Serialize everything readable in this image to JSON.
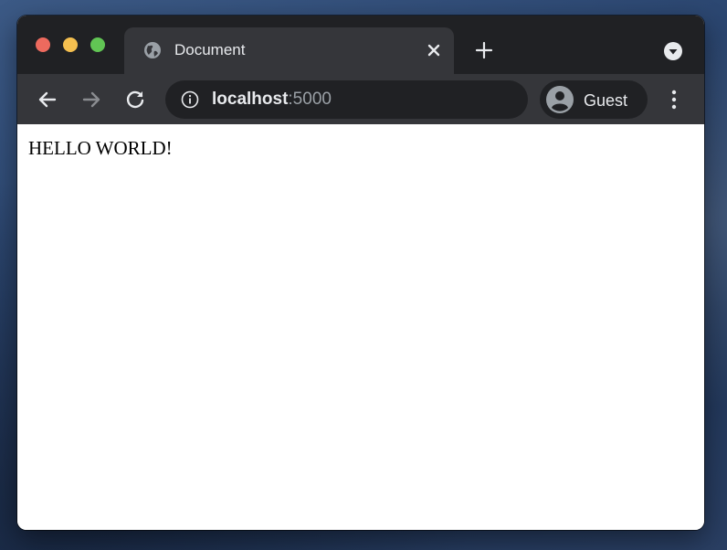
{
  "browser": {
    "tab": {
      "title": "Document",
      "favicon": "globe-icon"
    },
    "toolbar": {
      "url_host": "localhost",
      "url_port": ":5000",
      "profile_name": "Guest"
    },
    "icons": {
      "back": "back-arrow-icon",
      "forward": "forward-arrow-icon",
      "reload": "reload-icon",
      "info": "info-icon",
      "new_tab": "plus-icon",
      "tab_search": "chevron-down-circle-icon",
      "menu": "kebab-menu-icon",
      "close": "close-icon"
    },
    "colors": {
      "tabbar": "#202124",
      "toolbar": "#35363a",
      "text": "#e8eaed",
      "muted": "#9aa0a6",
      "traffic_close": "#ed6a5e",
      "traffic_minimize": "#f4bf4f",
      "traffic_maximize": "#61c554"
    }
  },
  "page": {
    "text": "HELLO WORLD!"
  }
}
